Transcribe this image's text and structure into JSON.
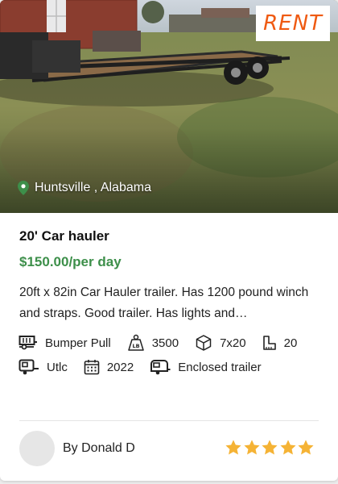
{
  "badge": {
    "label": "RENT"
  },
  "listing": {
    "location": "Huntsville , Alabama",
    "title": "20' Car hauler",
    "price": "$150.00/per day",
    "description": "20ft x 82in Car Hauler trailer. Has 1200 pound winch and straps. Good trailer. Has lights and…"
  },
  "specs": {
    "hitch": "Bumper Pull",
    "weight": "3500",
    "weight_icon_text": "LB",
    "size": "7x20",
    "length": "20",
    "make": "Utlc",
    "year": "2022",
    "type": "Enclosed trailer"
  },
  "owner": {
    "name": "By Donald D"
  },
  "rating": {
    "value": 5,
    "max": 5
  },
  "colors": {
    "badge_text": "#ef5a12",
    "price": "#3d8f4a",
    "star": "#f5b335",
    "pin": "#3d8f4a"
  },
  "icons": {
    "location": "map-pin-icon",
    "hitch": "trailer-hitch-icon",
    "weight": "weight-icon",
    "size": "box-icon",
    "length": "length-icon",
    "make": "trailer-icon",
    "year": "calendar-icon",
    "type": "camper-icon",
    "rating": "star-icon"
  }
}
